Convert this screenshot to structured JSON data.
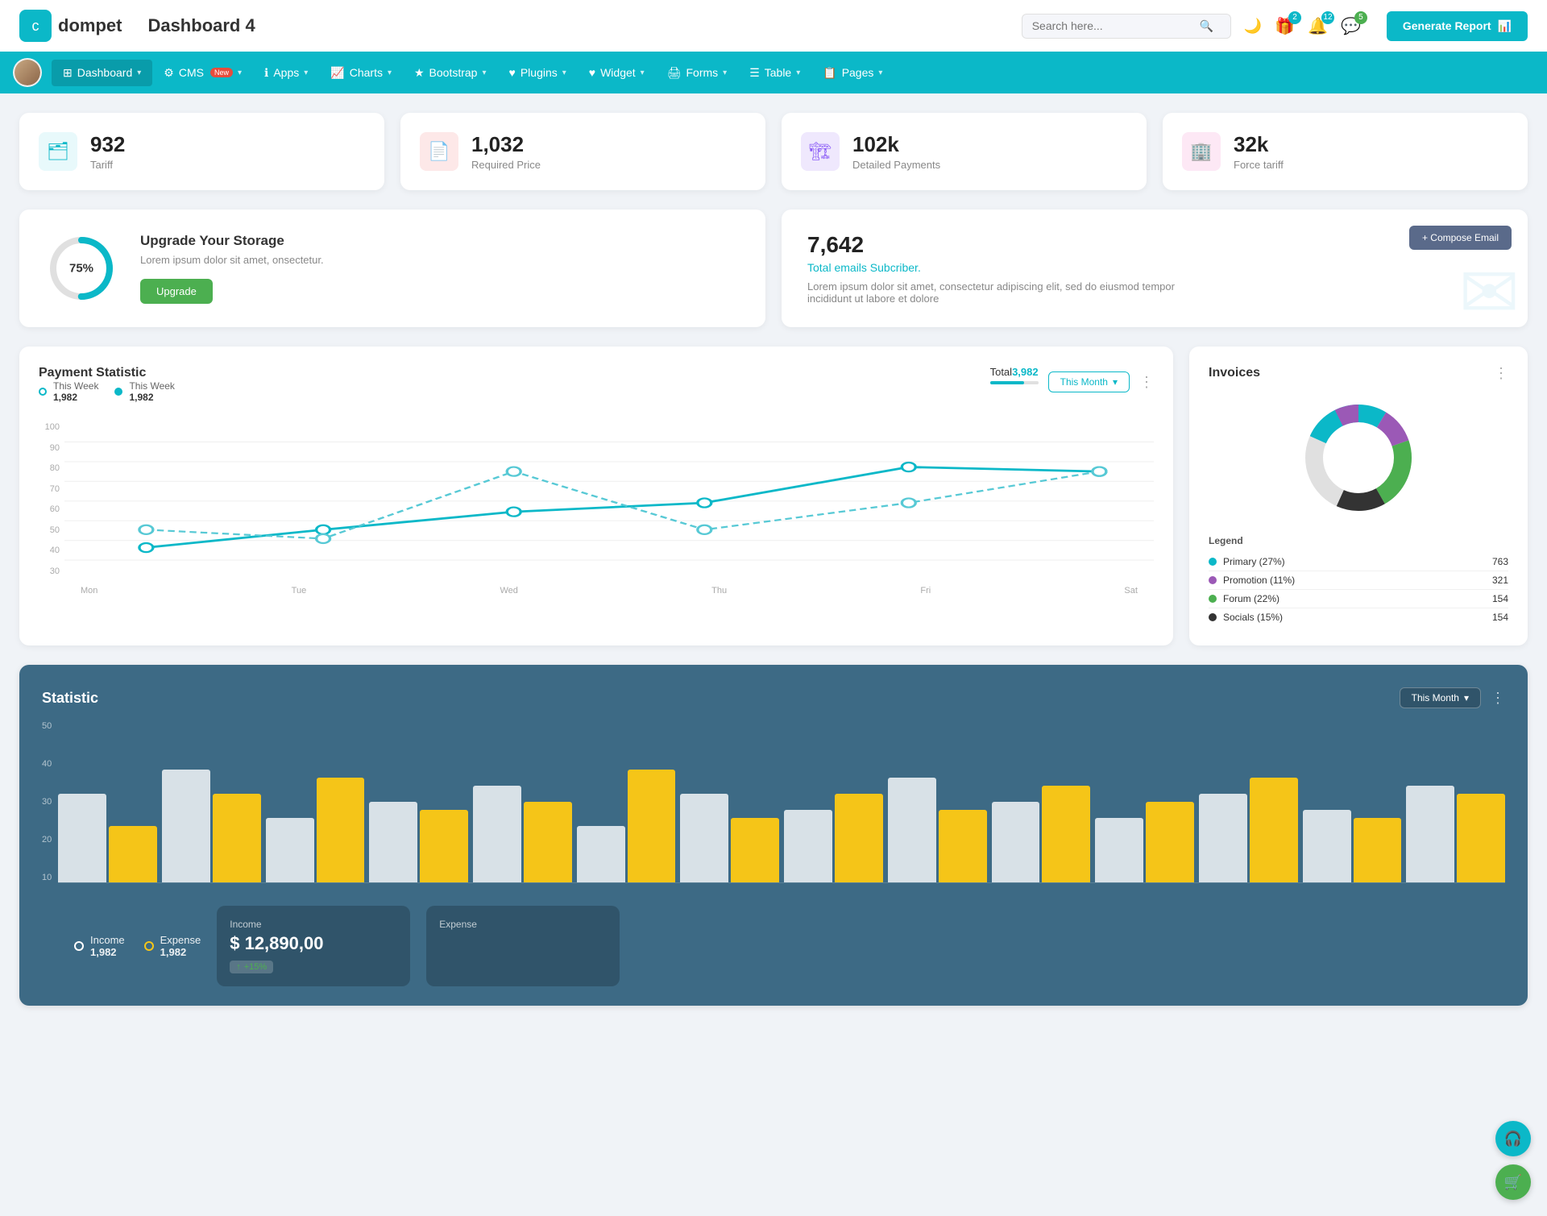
{
  "header": {
    "logo_icon": "💼",
    "logo_text": "dompet",
    "page_title": "Dashboard 4",
    "search_placeholder": "Search here...",
    "generate_btn_label": "Generate Report",
    "icons": {
      "moon": "🌙",
      "gift_badge": "2",
      "bell_badge": "12",
      "chat_badge": "5"
    }
  },
  "nav": {
    "items": [
      {
        "id": "dashboard",
        "label": "Dashboard",
        "active": true,
        "has_arrow": true,
        "icon": "⊞"
      },
      {
        "id": "cms",
        "label": "CMS",
        "active": false,
        "has_arrow": true,
        "icon": "⚙",
        "badge": "New"
      },
      {
        "id": "apps",
        "label": "Apps",
        "active": false,
        "has_arrow": true,
        "icon": "ℹ"
      },
      {
        "id": "charts",
        "label": "Charts",
        "active": false,
        "has_arrow": true,
        "icon": "📈"
      },
      {
        "id": "bootstrap",
        "label": "Bootstrap",
        "active": false,
        "has_arrow": true,
        "icon": "★"
      },
      {
        "id": "plugins",
        "label": "Plugins",
        "active": false,
        "has_arrow": true,
        "icon": "♥"
      },
      {
        "id": "widget",
        "label": "Widget",
        "active": false,
        "has_arrow": true,
        "icon": "♥"
      },
      {
        "id": "forms",
        "label": "Forms",
        "active": false,
        "has_arrow": true,
        "icon": "🖨"
      },
      {
        "id": "table",
        "label": "Table",
        "active": false,
        "has_arrow": true,
        "icon": "☰"
      },
      {
        "id": "pages",
        "label": "Pages",
        "active": false,
        "has_arrow": true,
        "icon": "📋"
      }
    ]
  },
  "stat_cards": [
    {
      "id": "tariff",
      "number": "932",
      "label": "Tariff",
      "icon_class": "teal",
      "icon": "🗂"
    },
    {
      "id": "required_price",
      "number": "1,032",
      "label": "Required Price",
      "icon_class": "red",
      "icon": "📄"
    },
    {
      "id": "detailed_payments",
      "number": "102k",
      "label": "Detailed Payments",
      "icon_class": "purple",
      "icon": "🏗"
    },
    {
      "id": "force_tariff",
      "number": "32k",
      "label": "Force tariff",
      "icon_class": "pink",
      "icon": "🏢"
    }
  ],
  "storage": {
    "percentage": "75%",
    "title": "Upgrade Your Storage",
    "description": "Lorem ipsum dolor sit amet, onsectetur.",
    "btn_label": "Upgrade",
    "donut_pct": 75
  },
  "email_card": {
    "number": "7,642",
    "subtitle": "Total emails Subcriber.",
    "description": "Lorem ipsum dolor sit amet, consectetur adipiscing elit, sed do eiusmod tempor incididunt ut labore et dolore",
    "compose_btn": "+ Compose Email"
  },
  "payment_chart": {
    "title": "Payment Statistic",
    "this_month_label": "This Month",
    "legend": [
      {
        "label": "This Week",
        "value": "1,982"
      },
      {
        "label": "This Week",
        "value": "1,982"
      }
    ],
    "total_label": "Total",
    "total_value": "3,982",
    "x_labels": [
      "Mon",
      "Tue",
      "Wed",
      "Thu",
      "Fri",
      "Sat"
    ],
    "y_labels": [
      "100",
      "90",
      "80",
      "70",
      "60",
      "50",
      "40",
      "30"
    ],
    "line1_points": "40,160 180,140 320,120 460,100 600,60 740,60",
    "line2_points": "40,120 180,130 320,60 460,120 600,80 740,60"
  },
  "invoices": {
    "title": "Invoices",
    "legend": [
      {
        "label": "Primary (27%)",
        "value": "763",
        "color": "#0bb8c8"
      },
      {
        "label": "Promotion (11%)",
        "value": "321",
        "color": "#9b59b6"
      },
      {
        "label": "Forum (22%)",
        "value": "154",
        "color": "#4caf50"
      },
      {
        "label": "Socials (15%)",
        "value": "154",
        "color": "#333"
      }
    ]
  },
  "statistic": {
    "title": "Statistic",
    "this_month_label": "This Month",
    "y_labels": [
      "50",
      "40",
      "30",
      "20",
      "10"
    ],
    "bars": [
      {
        "white": 55,
        "yellow": 35
      },
      {
        "white": 70,
        "yellow": 55
      },
      {
        "white": 40,
        "yellow": 65
      },
      {
        "white": 50,
        "yellow": 45
      },
      {
        "white": 60,
        "yellow": 50
      },
      {
        "white": 35,
        "yellow": 70
      },
      {
        "white": 55,
        "yellow": 40
      },
      {
        "white": 45,
        "yellow": 55
      },
      {
        "white": 65,
        "yellow": 45
      },
      {
        "white": 50,
        "yellow": 60
      },
      {
        "white": 40,
        "yellow": 50
      },
      {
        "white": 55,
        "yellow": 65
      },
      {
        "white": 45,
        "yellow": 40
      },
      {
        "white": 60,
        "yellow": 55
      }
    ],
    "income_label": "Income",
    "income_value": "1,982",
    "expense_label": "Expense",
    "expense_value": "1,982",
    "income_amount": "$ 12,890,00",
    "income_badge": "+15%",
    "expense_section_label": "Expense"
  }
}
